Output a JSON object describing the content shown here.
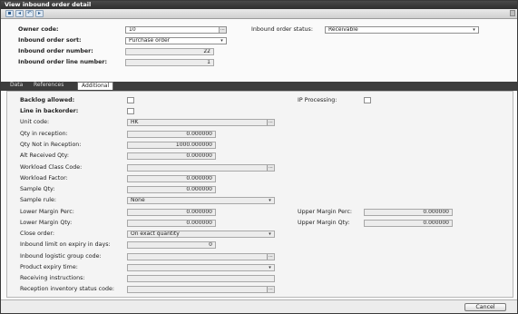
{
  "window": {
    "title": "View inbound order detail"
  },
  "toolbar": {
    "icons": [
      "save-icon",
      "back-icon",
      "undo-icon",
      "forward-icon"
    ]
  },
  "header": {
    "owner_code_label": "Owner code:",
    "owner_code_value": "10",
    "inbound_order_sort_label": "Inbound order sort:",
    "inbound_order_sort_value": "Purchase order",
    "inbound_order_number_label": "Inbound order number:",
    "inbound_order_number_value": "22",
    "inbound_order_line_number_label": "Inbound order line number:",
    "inbound_order_line_number_value": "1",
    "inbound_order_status_label": "Inbound order status:",
    "inbound_order_status_value": "Receivable"
  },
  "tabs": [
    {
      "label": "Data"
    },
    {
      "label": "References"
    },
    {
      "label": "Additional"
    }
  ],
  "additional": {
    "backlog_allowed": "Backlog allowed:",
    "line_in_backorder": "Line in backorder:",
    "unit_code": "Unit code:",
    "unit_code_value": "HK",
    "qty_in_reception": "Qty in reception:",
    "qty_in_reception_value": "0.000000",
    "qty_not_in_reception": "Qty Not in Reception:",
    "qty_not_in_reception_value": "1000.000000",
    "alt_received_qty": "Alt Received Qty:",
    "alt_received_qty_value": "0.000000",
    "workload_class_code": "Workload Class Code:",
    "workload_class_code_value": "",
    "workload_factor": "Workload Factor:",
    "workload_factor_value": "0.000000",
    "sample_qty": "Sample Qty:",
    "sample_qty_value": "0.000000",
    "sample_rule": "Sample rule:",
    "sample_rule_value": "None",
    "lower_margin_perc": "Lower Margin Perc:",
    "lower_margin_perc_value": "0.000000",
    "lower_margin_qty": "Lower Margin Qty:",
    "lower_margin_qty_value": "0.000000",
    "close_order": "Close order:",
    "close_order_value": "On exact quantity",
    "inbound_limit_on_expiry": "Inbound limit on expiry in days:",
    "inbound_limit_on_expiry_value": "0",
    "inbound_logistic_group_code": "Inbound logistic group code:",
    "product_expiry_time": "Product expiry time:",
    "receiving_instructions": "Receiving instructions:",
    "reception_inventory_status_code": "Reception inventory status code:",
    "ip_processing": "IP Processing:",
    "upper_margin_perc": "Upper Margin Perc:",
    "upper_margin_perc_value": "0.000000",
    "upper_margin_qty": "Upper Margin Qty:",
    "upper_margin_qty_value": "0.000000"
  },
  "footer": {
    "cancel_label": "Cancel"
  }
}
